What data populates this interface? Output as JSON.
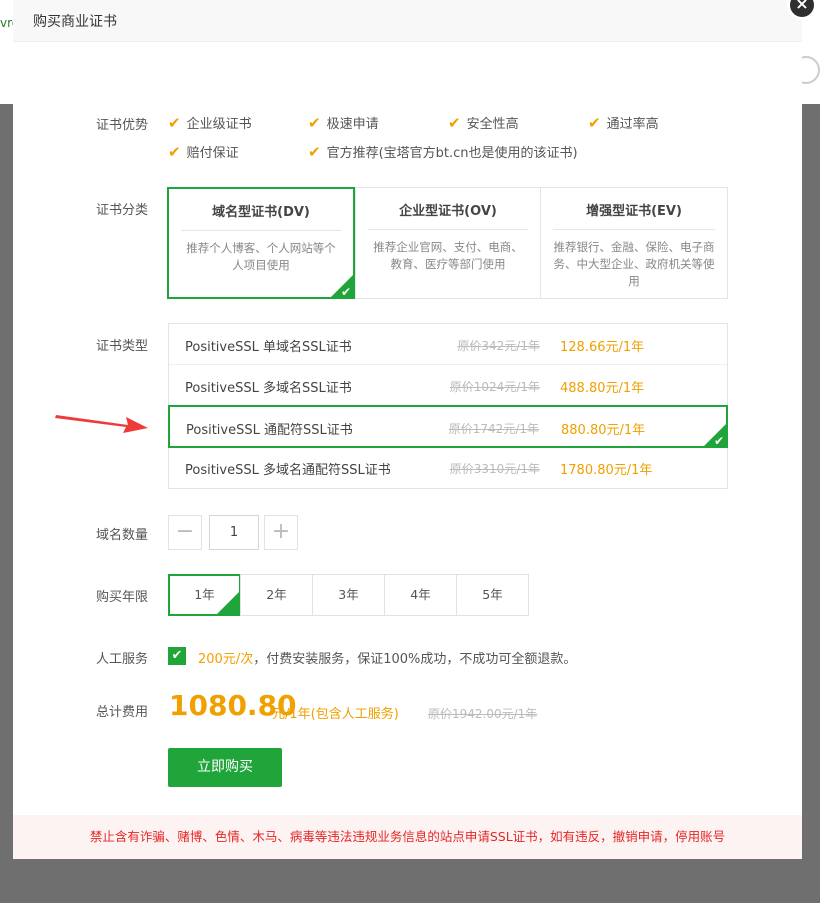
{
  "modal": {
    "title": "购买商业证书",
    "close_glyph": "×"
  },
  "background": {
    "left_fragment": "vro"
  },
  "advantages": {
    "label": "证书优势",
    "items": [
      "企业级证书",
      "极速申请",
      "安全性高",
      "通过率高",
      "赔付保证",
      "官方推荐(宝塔官方bt.cn也是使用的该证书)"
    ]
  },
  "categories": {
    "label": "证书分类",
    "items": [
      {
        "title": "域名型证书(DV)",
        "desc": "推荐个人博客、个人网站等个人项目使用"
      },
      {
        "title": "企业型证书(OV)",
        "desc": "推荐企业官网、支付、电商、教育、医疗等部门使用"
      },
      {
        "title": "增强型证书(EV)",
        "desc": "推荐银行、金融、保险、电子商务、中大型企业、政府机关等使用"
      }
    ]
  },
  "types": {
    "label": "证书类型",
    "rows": [
      {
        "name": "PositiveSSL 单域名SSL证书",
        "orig": "原价342元/1年",
        "price": "128.66元/1年"
      },
      {
        "name": "PositiveSSL 多域名SSL证书",
        "orig": "原价1024元/1年",
        "price": "488.80元/1年"
      },
      {
        "name": "PositiveSSL 通配符SSL证书",
        "orig": "原价1742元/1年",
        "price": "880.80元/1年"
      },
      {
        "name": "PositiveSSL 多域名通配符SSL证书",
        "orig": "原价3310元/1年",
        "price": "1780.80元/1年"
      }
    ]
  },
  "domains": {
    "label": "域名数量",
    "value": "1",
    "minus": "−",
    "plus": "+"
  },
  "years": {
    "label": "购买年限",
    "options": [
      "1年",
      "2年",
      "3年",
      "4年",
      "5年"
    ]
  },
  "service": {
    "label": "人工服务",
    "price": "200元/次",
    "text": "，付费安装服务，保证100%成功，不成功可全额退款。"
  },
  "total": {
    "label": "总计费用",
    "price": "1080.80",
    "unit": "元/1年(包含人工服务)",
    "orig": "原价1942.00元/1年"
  },
  "buy_button": "立即购买",
  "footer_notice": "禁止含有诈骗、赌博、色情、木马、病毒等违法违规业务信息的站点申请SSL证书，如有违反，撤销申请，停用账号",
  "colors": {
    "accent": "#20a53a",
    "price": "#f0a000",
    "warning": "#e52727"
  }
}
